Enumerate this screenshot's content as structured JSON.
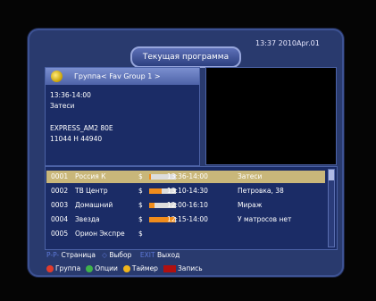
{
  "header": {
    "title": "Текущая программа",
    "clock": "13:37 2010Apr.01"
  },
  "info": {
    "group": "Группа< Fav Group 1 >",
    "time": "13:36-14:00",
    "event": "Затеси",
    "satellite": "EXPRESS_AM2 80E",
    "transponder": "11044 H 44940"
  },
  "channels": [
    {
      "num": "0001",
      "name": "Россия К",
      "flag": "$",
      "progress": 0.05,
      "time": "13:36-14:00",
      "program": "Затеси",
      "selected": true
    },
    {
      "num": "0002",
      "name": "ТВ Центр",
      "flag": "$",
      "progress": 0.45,
      "time": "13:10-14:30",
      "program": "Петровка, 38",
      "selected": false
    },
    {
      "num": "0003",
      "name": "Домашний",
      "flag": "$",
      "progress": 0.2,
      "time": "12:00-16:10",
      "program": "Мираж",
      "selected": false
    },
    {
      "num": "0004",
      "name": "Звезда",
      "flag": "$",
      "progress": 0.95,
      "time": "12:15-14:00",
      "program": "У матросов нет",
      "selected": false
    },
    {
      "num": "0005",
      "name": "Орион Экспре",
      "flag": "$",
      "progress": null,
      "time": "",
      "program": "",
      "selected": false
    }
  ],
  "help": {
    "page_key": "P-P-",
    "page_label": "Страница",
    "select_key": "◇",
    "select_label": "Выбор",
    "exit_key": "EXIT",
    "exit_label": "Выход"
  },
  "color_keys": [
    {
      "color": "#e23b2c",
      "label": "Группа",
      "shape": "dot"
    },
    {
      "color": "#3fb34b",
      "label": "Опции",
      "shape": "dot"
    },
    {
      "color": "#f0b51c",
      "label": "Таймер",
      "shape": "dot"
    },
    {
      "color": "#b01010",
      "label": "Запись",
      "shape": "rect"
    }
  ]
}
